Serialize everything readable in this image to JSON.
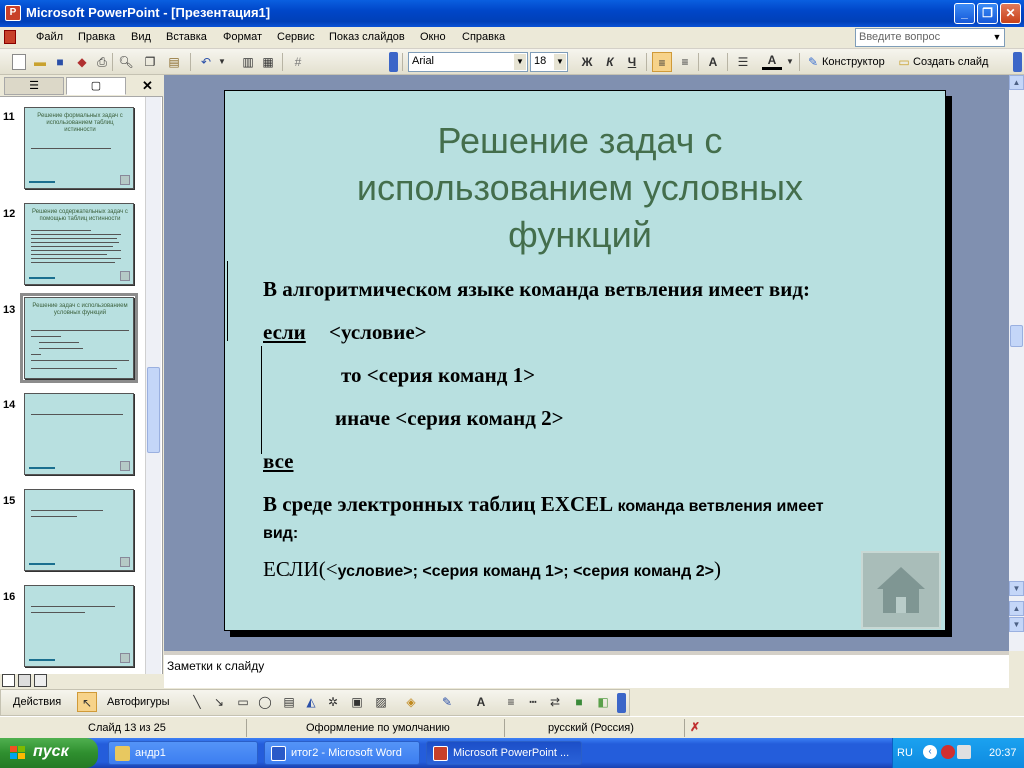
{
  "window": {
    "title": "Microsoft PowerPoint - [Презентация1]",
    "app_icon": "P",
    "minimize": "_",
    "restore": "❐",
    "close": "✕"
  },
  "menu": [
    "Файл",
    "Правка",
    "Вид",
    "Вставка",
    "Формат",
    "Сервис",
    "Показ слайдов",
    "Окно",
    "Справка"
  ],
  "ask": {
    "placeholder": "Введите вопрос"
  },
  "toolbar": {
    "font": "Arial",
    "size": "18",
    "bold": "Ж",
    "italic": "К",
    "underline": "Ч",
    "designer": "Конструктор",
    "new_slide": "Создать слайд"
  },
  "left_panel": {
    "tabs": [
      "☰",
      "▢"
    ],
    "close": "✕",
    "slides": [
      {
        "num": "11",
        "title": "Решение формальных задач с использованием  таблиц истинности"
      },
      {
        "num": "12",
        "title": "Решение содержательных задач с помощью таблиц истинности"
      },
      {
        "num": "13",
        "title": "Решение задач с использованием условных функций"
      },
      {
        "num": "14",
        "title": ""
      },
      {
        "num": "15",
        "title": ""
      },
      {
        "num": "16",
        "title": ""
      }
    ]
  },
  "slide": {
    "title": "Решение задач с использованием условных функций",
    "line1": "В алгоритмическом языке команда ветвления имеет вид:",
    "if_kw": "если",
    "cond": "<условие>",
    "then": "то <серия команд 1>",
    "else": "иначе <серия команд 2>",
    "end_kw": "все",
    "excel_line_a": "В среде электронных таблиц EXCEL",
    "excel_line_b": " команда ветвления имеет",
    "excel_line_c": "вид:",
    "formula_a": "ЕСЛИ(<",
    "formula_b": "условие>; <серия команд 1>; <серия команд 2>",
    "formula_c": ")"
  },
  "notes": {
    "placeholder": "Заметки к слайду"
  },
  "drawbar": {
    "actions": "Действия",
    "autoshapes": "Автофигуры"
  },
  "status": {
    "slide": "Слайд 13 из 25",
    "design": "Оформление по умолчанию",
    "lang": "русский (Россия)"
  },
  "taskbar": {
    "start": "пуск",
    "tasks": [
      "андр1",
      "итог2 - Microsoft Word",
      "Microsoft PowerPoint ..."
    ],
    "lang": "RU",
    "time": "20:37"
  },
  "colors": {
    "slide_bg": "#b8e0e0",
    "title_green": "#446e4c",
    "workspace": "#8090b0",
    "taskbar": "#245ddb"
  }
}
